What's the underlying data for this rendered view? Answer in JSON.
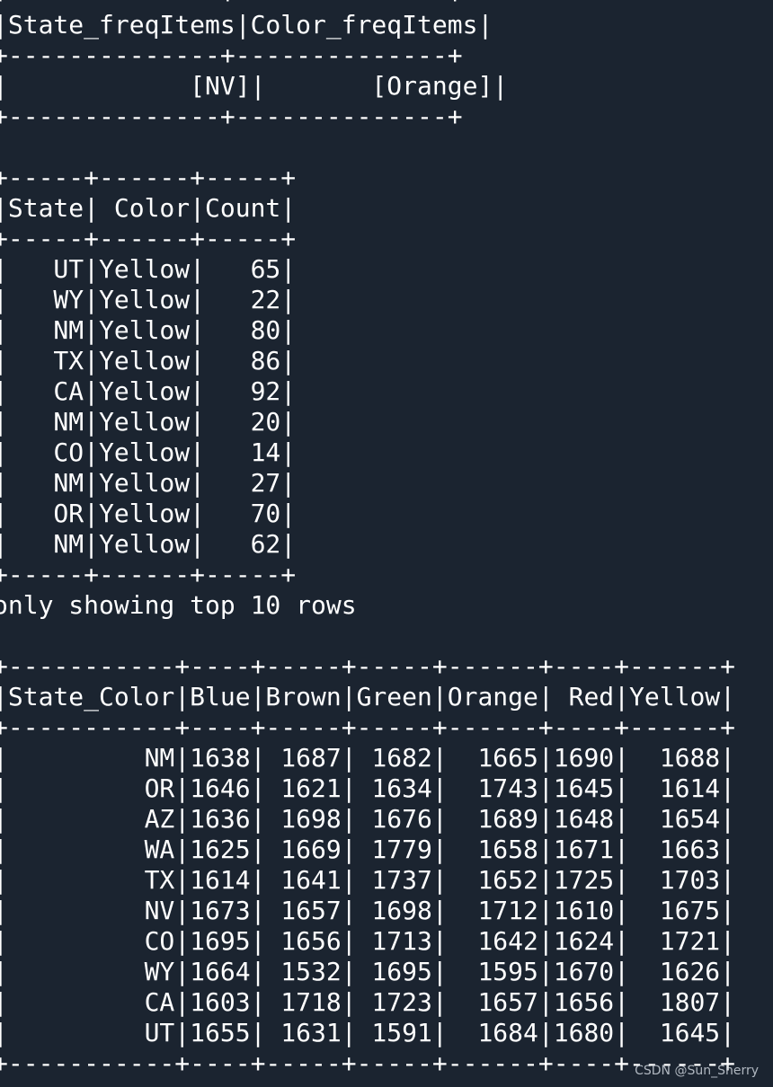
{
  "terminal_output": {
    "lines": [
      "+--------------+--------------+",
      "|State_freqItems|Color_freqItems|",
      "+--------------+--------------+",
      "|            [NV]|       [Orange]|",
      "+--------------+--------------+",
      "",
      "+-----+------+-----+",
      "|State| Color|Count|",
      "+-----+------+-----+",
      "|   UT|Yellow|   65|",
      "|   WY|Yellow|   22|",
      "|   NM|Yellow|   80|",
      "|   TX|Yellow|   86|",
      "|   CA|Yellow|   92|",
      "|   NM|Yellow|   20|",
      "|   CO|Yellow|   14|",
      "|   NM|Yellow|   27|",
      "|   OR|Yellow|   70|",
      "|   NM|Yellow|   62|",
      "+-----+------+-----+",
      "only showing top 10 rows",
      "",
      "+-----------+----+-----+-----+------+----+------+",
      "|State_Color|Blue|Brown|Green|Orange| Red|Yellow|",
      "+-----------+----+-----+-----+------+----+------+",
      "|         NM|1638| 1687| 1682|  1665|1690|  1688|",
      "|         OR|1646| 1621| 1634|  1743|1645|  1614|",
      "|         AZ|1636| 1698| 1676|  1689|1648|  1654|",
      "|         WA|1625| 1669| 1779|  1658|1671|  1663|",
      "|         TX|1614| 1641| 1737|  1652|1725|  1703|",
      "|         NV|1673| 1657| 1698|  1712|1610|  1675|",
      "|         CO|1695| 1656| 1713|  1642|1624|  1721|",
      "|         WY|1664| 1532| 1695|  1595|1670|  1626|",
      "|         CA|1603| 1718| 1723|  1657|1656|  1807|",
      "|         UT|1655| 1631| 1591|  1684|1680|  1645|",
      "+-----------+----+-----+-----+------+----+------+"
    ]
  },
  "watermark": "CSDN @Sun_Sherry"
}
